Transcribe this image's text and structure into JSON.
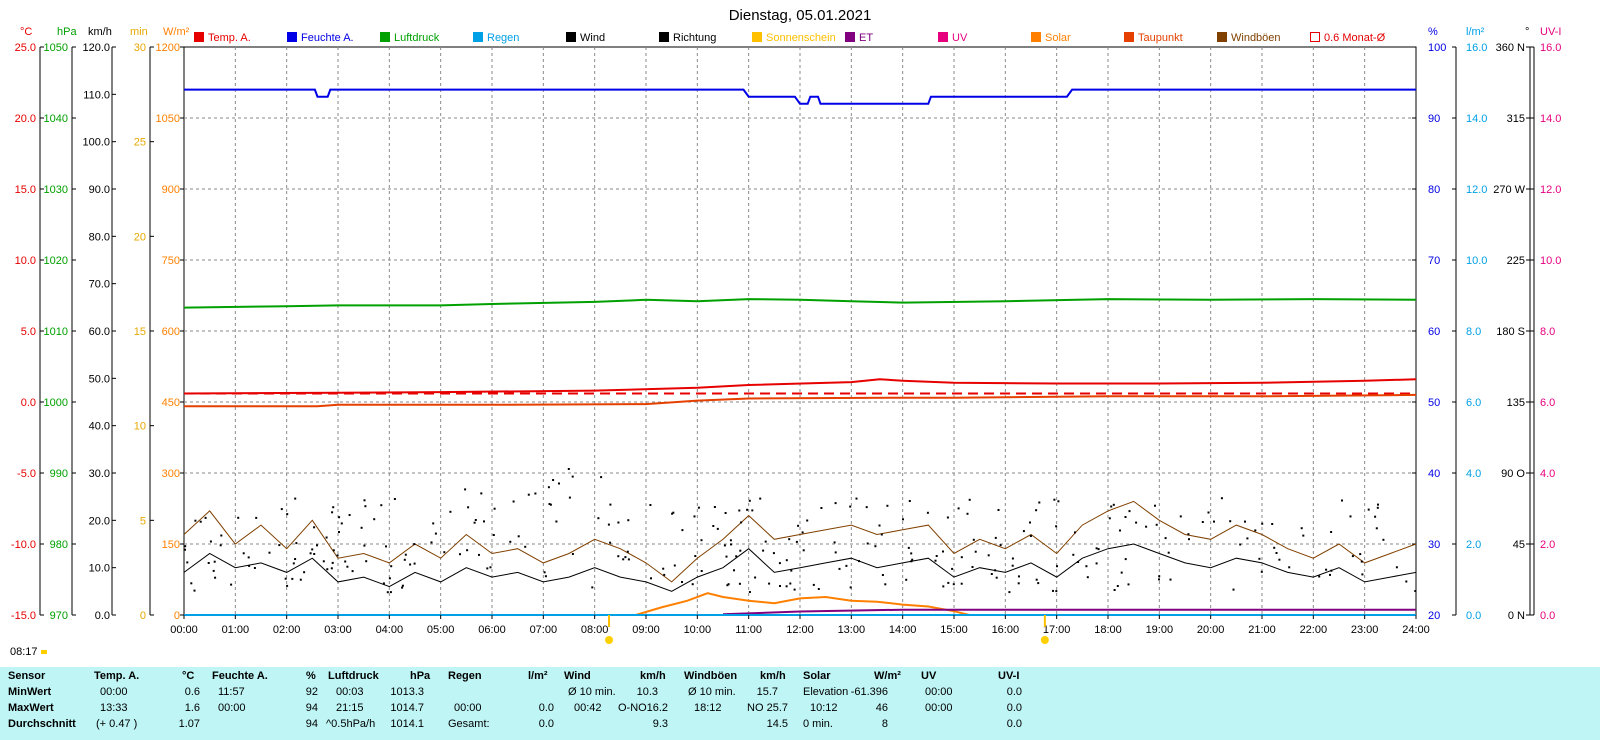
{
  "chart_data": {
    "type": "line",
    "title": "Dienstag, 05.01.2021",
    "time_axis": {
      "ticks": [
        "00:00",
        "01:00",
        "02:00",
        "03:00",
        "04:00",
        "05:00",
        "06:00",
        "07:00",
        "08:00",
        "09:00",
        "10:00",
        "11:00",
        "12:00",
        "13:00",
        "14:00",
        "15:00",
        "16:00",
        "17:00",
        "18:00",
        "19:00",
        "20:00",
        "21:00",
        "22:00",
        "23:00",
        "24:00"
      ],
      "range_hours": [
        0,
        24
      ]
    },
    "axes": {
      "temp": {
        "unit": "°C",
        "color": "#e60000",
        "range": [
          -15,
          25
        ],
        "ticks": [
          "25.0",
          "20.0",
          "15.0",
          "10.0",
          "5.0",
          "0.0",
          "-5.0",
          "-10.0",
          "-15.0"
        ]
      },
      "pressure": {
        "unit": "hPa",
        "color": "#00a000",
        "range": [
          970,
          1050
        ],
        "ticks": [
          "1050",
          "1040",
          "1030",
          "1020",
          "1010",
          "1000",
          "990",
          "980",
          "970"
        ]
      },
      "wind": {
        "unit": "km/h",
        "color": "#000000",
        "range": [
          0,
          120
        ],
        "ticks": [
          "120.0",
          "110.0",
          "100.0",
          "90.0",
          "80.0",
          "70.0",
          "60.0",
          "50.0",
          "40.0",
          "30.0",
          "20.0",
          "10.0",
          "0.0"
        ]
      },
      "sunmin": {
        "unit": "min",
        "color": "#e6a800",
        "range": [
          0,
          30
        ],
        "ticks": [
          "30",
          "25",
          "20",
          "15",
          "10",
          "5",
          "0"
        ]
      },
      "solar": {
        "unit": "W/m²",
        "color": "#ff8000",
        "range": [
          0,
          1200
        ],
        "ticks": [
          "1200",
          "1050",
          "900",
          "750",
          "600",
          "450",
          "300",
          "150",
          "0"
        ]
      },
      "humidity": {
        "unit": "%",
        "color": "#0000e6",
        "range": [
          20,
          100
        ],
        "ticks": [
          "100",
          "90",
          "80",
          "70",
          "60",
          "50",
          "40",
          "30",
          "20"
        ]
      },
      "rain": {
        "unit": "l/m²",
        "color": "#00a0e6",
        "range": [
          0,
          16
        ],
        "ticks": [
          "16.0",
          "14.0",
          "12.0",
          "10.0",
          "8.0",
          "6.0",
          "4.0",
          "2.0",
          "0.0"
        ]
      },
      "direction": {
        "unit": "°",
        "color": "#000000",
        "range": [
          0,
          360
        ],
        "ticks": [
          "360 N",
          "315",
          "270 W",
          "225",
          "180 S",
          "135",
          "90 O",
          "45",
          "0 N"
        ]
      },
      "uv": {
        "unit": "UV-I",
        "color": "#e6007e",
        "range": [
          0,
          16
        ],
        "ticks": [
          "16.0",
          "14.0",
          "12.0",
          "10.0",
          "8.0",
          "6.0",
          "4.0",
          "2.0",
          "0.0"
        ]
      }
    },
    "legend": [
      {
        "name": "Temp. A.",
        "color": "#e60000"
      },
      {
        "name": "Feuchte A.",
        "color": "#0000e6"
      },
      {
        "name": "Luftdruck",
        "color": "#00a000"
      },
      {
        "name": "Regen",
        "color": "#00a0e6"
      },
      {
        "name": "Wind",
        "color": "#000000"
      },
      {
        "name": "Richtung",
        "color": "#000000"
      },
      {
        "name": "Sonnenschein",
        "color": "#ffc000"
      },
      {
        "name": "ET",
        "color": "#800080"
      },
      {
        "name": "UV",
        "color": "#e6007e"
      },
      {
        "name": "Solar",
        "color": "#ff8000"
      },
      {
        "name": "Taupunkt",
        "color": "#e64000"
      },
      {
        "name": "Windböen",
        "color": "#804000"
      },
      {
        "name": "0.6 Monat-Ø",
        "color": "#e60000"
      }
    ],
    "series": [
      {
        "name": "Luftdruck",
        "axis": "pressure",
        "color": "#00a000",
        "points": [
          [
            0,
            1013.3
          ],
          [
            2,
            1013.5
          ],
          [
            3,
            1013.6
          ],
          [
            5,
            1013.6
          ],
          [
            6,
            1013.8
          ],
          [
            8,
            1014.1
          ],
          [
            9,
            1014.4
          ],
          [
            10,
            1014.2
          ],
          [
            11,
            1014.5
          ],
          [
            12,
            1014.4
          ],
          [
            13,
            1014.2
          ],
          [
            14,
            1014.0
          ],
          [
            16,
            1014.2
          ],
          [
            18,
            1014.5
          ],
          [
            20,
            1014.4
          ],
          [
            22,
            1014.5
          ],
          [
            24,
            1014.4
          ]
        ]
      },
      {
        "name": "Feuchte A.",
        "axis": "humidity",
        "color": "#0000e6",
        "points": [
          [
            0,
            94
          ],
          [
            2.55,
            94
          ],
          [
            2.6,
            93
          ],
          [
            2.8,
            93
          ],
          [
            2.85,
            94
          ],
          [
            10.9,
            94
          ],
          [
            11.0,
            93
          ],
          [
            11.9,
            93
          ],
          [
            12.0,
            92
          ],
          [
            12.15,
            92
          ],
          [
            12.2,
            93
          ],
          [
            12.35,
            93
          ],
          [
            12.4,
            92
          ],
          [
            14.5,
            92
          ],
          [
            14.55,
            93
          ],
          [
            17.2,
            93
          ],
          [
            17.3,
            94
          ],
          [
            24,
            94
          ]
        ]
      },
      {
        "name": "Temp. A.",
        "axis": "temp",
        "color": "#e60000",
        "points": [
          [
            0,
            0.6
          ],
          [
            3,
            0.65
          ],
          [
            5,
            0.7
          ],
          [
            8,
            0.8
          ],
          [
            10,
            1.0
          ],
          [
            11,
            1.2
          ],
          [
            13,
            1.4
          ],
          [
            13.55,
            1.6
          ],
          [
            14,
            1.5
          ],
          [
            15,
            1.35
          ],
          [
            17,
            1.3
          ],
          [
            19,
            1.3
          ],
          [
            21,
            1.35
          ],
          [
            23,
            1.5
          ],
          [
            24,
            1.6
          ]
        ]
      },
      {
        "name": "0.6 Monat-Ø",
        "axis": "temp",
        "color": "#e60000",
        "dashed": true,
        "points": [
          [
            0,
            0.6
          ],
          [
            24,
            0.6
          ]
        ]
      },
      {
        "name": "Taupunkt",
        "axis": "temp",
        "color": "#e64000",
        "points": [
          [
            0,
            -0.3
          ],
          [
            2.6,
            -0.3
          ],
          [
            3,
            -0.2
          ],
          [
            6,
            -0.2
          ],
          [
            9,
            -0.15
          ],
          [
            10,
            0.1
          ],
          [
            11,
            0.25
          ],
          [
            14,
            0.3
          ],
          [
            15,
            0.3
          ],
          [
            18,
            0.4
          ],
          [
            21,
            0.4
          ],
          [
            24,
            0.5
          ]
        ]
      },
      {
        "name": "Solar",
        "axis": "solar",
        "color": "#ff8000",
        "points": [
          [
            8.2,
            0
          ],
          [
            8.8,
            0
          ],
          [
            9.3,
            16
          ],
          [
            9.8,
            30
          ],
          [
            10.2,
            46
          ],
          [
            10.5,
            38
          ],
          [
            11,
            30
          ],
          [
            11.5,
            25
          ],
          [
            12,
            35
          ],
          [
            12.5,
            38
          ],
          [
            13,
            30
          ],
          [
            13.5,
            28
          ],
          [
            14,
            22
          ],
          [
            14.5,
            18
          ],
          [
            15,
            8
          ],
          [
            15.3,
            0
          ]
        ]
      },
      {
        "name": "Wind",
        "axis": "wind",
        "color": "#000000",
        "points": [
          [
            0,
            9
          ],
          [
            0.5,
            13
          ],
          [
            1,
            10
          ],
          [
            1.5,
            11
          ],
          [
            2,
            9
          ],
          [
            2.5,
            12
          ],
          [
            3,
            7
          ],
          [
            3.5,
            8
          ],
          [
            4,
            6
          ],
          [
            4.5,
            9
          ],
          [
            5,
            7
          ],
          [
            5.5,
            10
          ],
          [
            6,
            8
          ],
          [
            6.5,
            9
          ],
          [
            7,
            7
          ],
          [
            7.5,
            8
          ],
          [
            8,
            10
          ],
          [
            8.5,
            8
          ],
          [
            9,
            7
          ],
          [
            9.5,
            5
          ],
          [
            10,
            8
          ],
          [
            10.5,
            10
          ],
          [
            11,
            14
          ],
          [
            11.5,
            9
          ],
          [
            12,
            10
          ],
          [
            12.5,
            11
          ],
          [
            13,
            12
          ],
          [
            13.5,
            10
          ],
          [
            14,
            11
          ],
          [
            14.5,
            12
          ],
          [
            15,
            8
          ],
          [
            15.5,
            10
          ],
          [
            16,
            9
          ],
          [
            16.5,
            11
          ],
          [
            17,
            8
          ],
          [
            17.5,
            12
          ],
          [
            18,
            14
          ],
          [
            18.5,
            15
          ],
          [
            19,
            13
          ],
          [
            19.5,
            11
          ],
          [
            20,
            10
          ],
          [
            20.5,
            12
          ],
          [
            21,
            11
          ],
          [
            21.5,
            9
          ],
          [
            22,
            8
          ],
          [
            22.5,
            10
          ],
          [
            23,
            7
          ],
          [
            23.5,
            8
          ],
          [
            24,
            9
          ]
        ]
      },
      {
        "name": "Windböen",
        "axis": "wind",
        "color": "#804000",
        "points": [
          [
            0,
            17
          ],
          [
            0.5,
            22
          ],
          [
            1,
            15
          ],
          [
            1.5,
            19
          ],
          [
            2,
            14
          ],
          [
            2.5,
            20
          ],
          [
            3,
            12
          ],
          [
            3.5,
            13
          ],
          [
            4,
            11
          ],
          [
            4.5,
            15
          ],
          [
            5,
            12
          ],
          [
            5.5,
            17
          ],
          [
            6,
            13
          ],
          [
            6.5,
            14
          ],
          [
            7,
            11
          ],
          [
            7.5,
            13
          ],
          [
            8,
            16
          ],
          [
            8.5,
            14
          ],
          [
            9,
            11
          ],
          [
            9.5,
            7
          ],
          [
            10,
            12
          ],
          [
            10.5,
            16
          ],
          [
            11,
            21
          ],
          [
            11.5,
            16
          ],
          [
            12,
            17
          ],
          [
            12.5,
            18
          ],
          [
            13,
            19
          ],
          [
            13.5,
            17
          ],
          [
            14,
            18
          ],
          [
            14.5,
            19
          ],
          [
            15,
            13
          ],
          [
            15.5,
            16
          ],
          [
            16,
            14
          ],
          [
            16.5,
            17
          ],
          [
            17,
            13
          ],
          [
            17.5,
            19
          ],
          [
            18,
            22
          ],
          [
            18.5,
            24
          ],
          [
            19,
            20
          ],
          [
            19.5,
            17
          ],
          [
            20,
            16
          ],
          [
            20.5,
            19
          ],
          [
            21,
            17
          ],
          [
            21.5,
            14
          ],
          [
            22,
            12
          ],
          [
            22.5,
            15
          ],
          [
            23,
            11
          ],
          [
            23.5,
            13
          ],
          [
            24,
            15
          ]
        ]
      },
      {
        "name": "UV",
        "axis": "uv",
        "color": "#800080",
        "points": [
          [
            10.5,
            0.02
          ],
          [
            12,
            0.1
          ],
          [
            14,
            0.15
          ],
          [
            16,
            0.15
          ],
          [
            20,
            0.15
          ],
          [
            24,
            0.15
          ]
        ]
      },
      {
        "name": "Regen",
        "axis": "rain",
        "color": "#00a0e6",
        "points": [
          [
            0,
            0
          ],
          [
            24,
            0
          ]
        ]
      }
    ],
    "annotations": {
      "sunrise": "08:17",
      "sunrise_hour": 8.28,
      "sunset_hour": 16.77
    }
  },
  "summary": {
    "headers": {
      "sensor": "Sensor",
      "temp": "Temp. A.",
      "temp_unit": "°C",
      "hum": "Feuchte A.",
      "hum_unit": "%",
      "press": "Luftdruck",
      "press_unit": "hPa",
      "rain": "Regen",
      "rain_unit": "l/m²",
      "wind": "Wind",
      "wind_unit": "km/h",
      "gust": "Windböen",
      "gust_unit": "km/h",
      "solar": "Solar",
      "solar_unit": "W/m²",
      "uv": "UV",
      "uv_unit": "UV-I"
    },
    "rows": [
      {
        "label": "MinWert",
        "temp_time": "00:00",
        "temp": "0.6",
        "hum_time": "11:57",
        "hum": "92",
        "press_time": "00:03",
        "press": "1013.3",
        "rain_time": "",
        "rain": "",
        "wind_label": "Ø 10 min.",
        "wind": "10.3",
        "gust_label": "Ø 10 min.",
        "gust": "15.7",
        "solar_label": "Elevation",
        "solar": "-61.396",
        "uv_time": "00:00",
        "uv": "0.0"
      },
      {
        "label": "MaxWert",
        "temp_time": "13:33",
        "temp": "1.6",
        "hum_time": "00:00",
        "hum": "94",
        "press_time": "21:15",
        "press": "1014.7",
        "rain_time": "00:00",
        "rain": "0.0",
        "wind_label": "00:42",
        "wind_dir": "O-NO",
        "wind": "16.2",
        "gust_label": "18:12",
        "gust_dir": "NO",
        "gust": "25.7",
        "solar_label": "10:12",
        "solar": "46",
        "uv_time": "00:00",
        "uv": "0.0"
      },
      {
        "label": "Durchschnitt",
        "temp_time": "(+ 0.47 )",
        "temp": "1.07",
        "hum_time": "",
        "hum": "94",
        "press_time": "^0.5hPa/h",
        "press": "1014.1",
        "rain_time": "Gesamt:",
        "rain": "0.0",
        "wind_label": "",
        "wind": "9.3",
        "gust_label": "",
        "gust": "14.5",
        "solar_label": "0 min.",
        "solar": "8",
        "uv_time": "",
        "uv": "0.0"
      }
    ]
  }
}
